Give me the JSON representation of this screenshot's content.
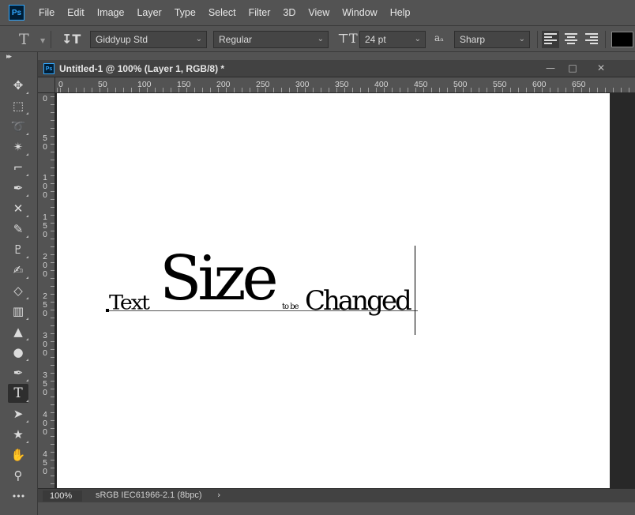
{
  "app": {
    "logo_text": "Ps",
    "menu": [
      "File",
      "Edit",
      "Image",
      "Layer",
      "Type",
      "Select",
      "Filter",
      "3D",
      "View",
      "Window",
      "Help"
    ]
  },
  "options": {
    "tool_icon": "T",
    "font_family": "Giddyup Std",
    "font_style": "Regular",
    "font_size": "24 pt",
    "aa_icon": "aₐ",
    "antialias": "Sharp",
    "text_color": "#000000"
  },
  "toolbar": {
    "tools": [
      {
        "name": "move-tool-icon",
        "glyph": "✥"
      },
      {
        "name": "marquee-tool-icon",
        "glyph": "⬚"
      },
      {
        "name": "lasso-tool-icon",
        "glyph": "➰"
      },
      {
        "name": "magic-wand-icon",
        "glyph": "✴"
      },
      {
        "name": "crop-tool-icon",
        "glyph": "⌐"
      },
      {
        "name": "eyedropper-icon",
        "glyph": "✒"
      },
      {
        "name": "healing-brush-icon",
        "glyph": "✕"
      },
      {
        "name": "brush-tool-icon",
        "glyph": "✎"
      },
      {
        "name": "clone-stamp-icon",
        "glyph": "♇"
      },
      {
        "name": "history-brush-icon",
        "glyph": "✍"
      },
      {
        "name": "eraser-tool-icon",
        "glyph": "◇"
      },
      {
        "name": "gradient-tool-icon",
        "glyph": "▥"
      },
      {
        "name": "blur-tool-icon",
        "glyph": "▲"
      },
      {
        "name": "dodge-tool-icon",
        "glyph": "●"
      },
      {
        "name": "pen-tool-icon",
        "glyph": "✒"
      },
      {
        "name": "type-tool-icon",
        "glyph": "T"
      },
      {
        "name": "path-selection-icon",
        "glyph": "➤"
      },
      {
        "name": "shape-tool-icon",
        "glyph": "★"
      },
      {
        "name": "hand-tool-icon",
        "glyph": "✋"
      },
      {
        "name": "zoom-tool-icon",
        "glyph": "⚲"
      },
      {
        "name": "more-tools-icon",
        "glyph": "•••"
      }
    ]
  },
  "document": {
    "title": "Untitled-1 @ 100% (Layer 1, RGB/8) *",
    "ruler_h": [
      "0",
      "50",
      "100",
      "150",
      "200",
      "250",
      "300",
      "350",
      "400",
      "450",
      "500",
      "550",
      "600",
      "650"
    ],
    "ruler_v": [
      "0",
      "5\n0",
      "1\n0\n0",
      "1\n5\n0",
      "2\n0\n0",
      "2\n5\n0",
      "3\n0\n0",
      "3\n5\n0",
      "4\n0\n0",
      "4\n5\n0"
    ],
    "canvas_words": {
      "text": "Text",
      "size": "Size",
      "tobe": "to be",
      "changed": "Changed"
    },
    "zoom": "100%",
    "color_profile": "sRGB IEC61966-2.1 (8bpc)"
  }
}
